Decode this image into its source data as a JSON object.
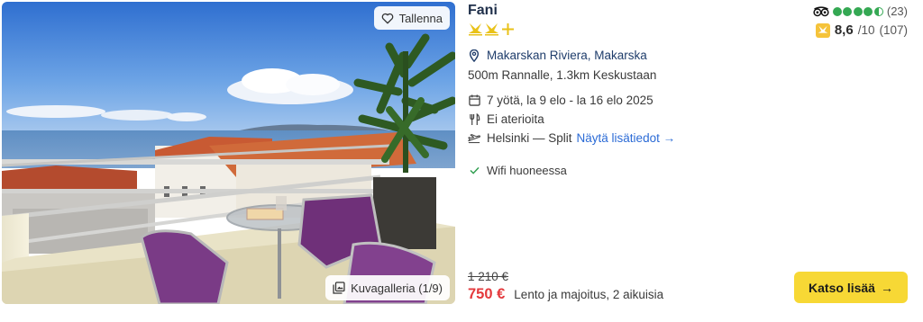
{
  "hotel": {
    "name": "Fani",
    "stars_full": 2,
    "stars_half": 1,
    "location": "Makarskan Riviera, Makarska",
    "distances": "500m Rannalle, 1.3km Keskustaan",
    "dates": "7 yötä, la 9 elo - la 16 elo 2025",
    "meals": "Ei aterioita",
    "flight": "Helsinki — Split",
    "flight_link": "Näytä lisätiedot →",
    "feature": "Wifi huoneessa"
  },
  "photo": {
    "save_label": "Tallenna",
    "gallery_label": "Kuvagalleria (1/9)"
  },
  "tripadvisor": {
    "rating_dots": 4.5,
    "review_count": "(23)",
    "accent": "#34a853"
  },
  "guest_rating": {
    "score": "8,6",
    "scale": "/10",
    "count": "(107)",
    "badge_color": "#f5c33a"
  },
  "pricing": {
    "old_price": "1 210 €",
    "price": "750 €",
    "description": "Lento ja majoitus, 2 aikuisia",
    "price_color": "#e4393c"
  },
  "cta": {
    "label": "Katso lisää",
    "arrow": "→",
    "color": "#f7d835"
  }
}
